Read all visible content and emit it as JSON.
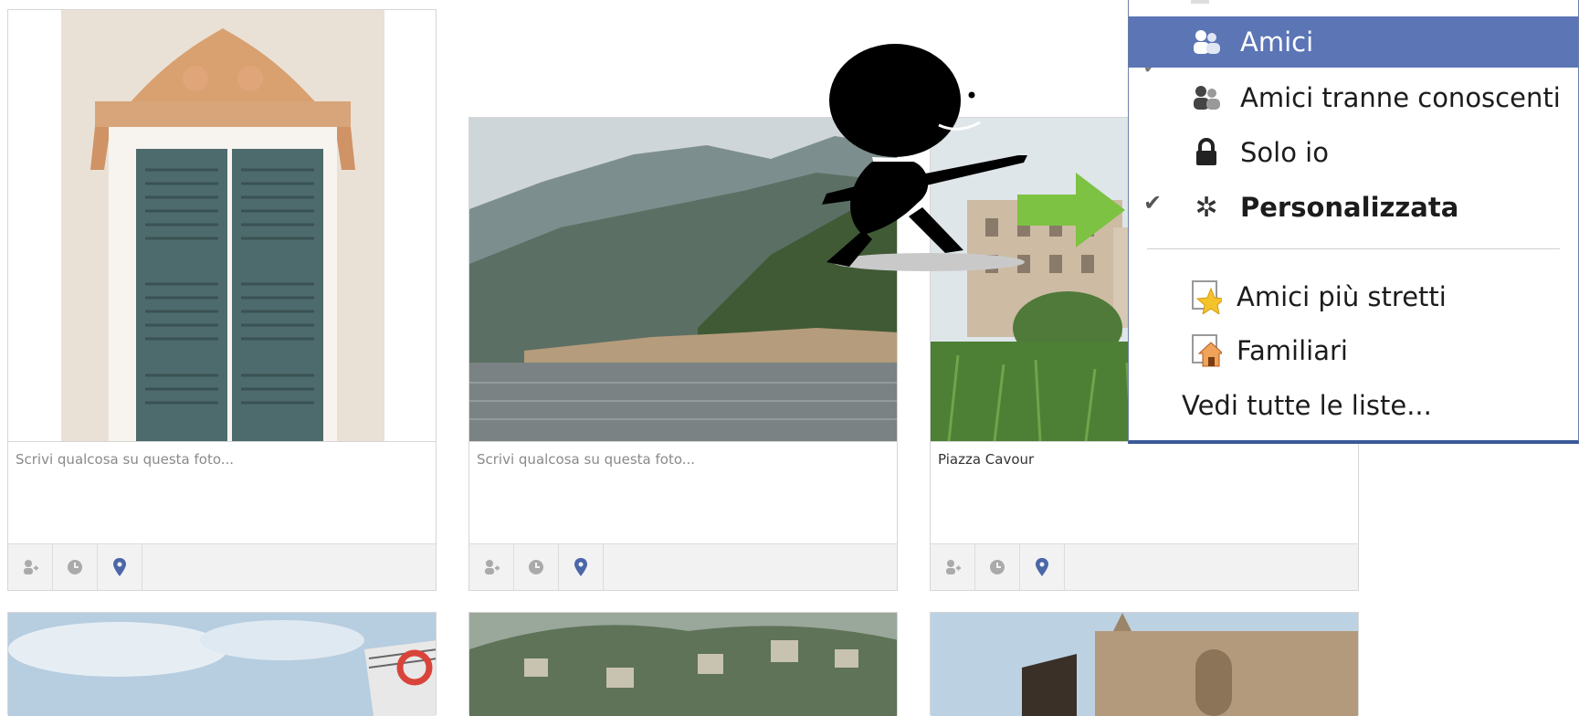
{
  "captions": {
    "photo1": "Scrivi qualcosa su questa foto...",
    "photo2": "Scrivi qualcosa su questa foto...",
    "photo3": "Piazza Cavour"
  },
  "toolbar_icons": [
    "tag-person-icon",
    "clock-icon",
    "location-pin-icon"
  ],
  "privacy_menu": {
    "items": [
      {
        "label": "Amici",
        "icon": "friends-icon",
        "selected": false,
        "highlighted": true
      },
      {
        "label": "Amici tranne conoscenti",
        "icon": "friends-except-icon",
        "selected": false
      },
      {
        "label": "Solo io",
        "icon": "lock-icon",
        "selected": false
      },
      {
        "label": "Personalizzata",
        "icon": "gear-icon",
        "selected": true
      }
    ],
    "lists": [
      {
        "label": "Amici più stretti",
        "icon": "star-list-icon"
      },
      {
        "label": "Familiari",
        "icon": "house-list-icon"
      }
    ],
    "see_all": "Vedi tutte le liste..."
  },
  "colors": {
    "highlight": "#5b75b5",
    "menu_border": "#3b5998",
    "arrow": "#7dc242",
    "pin": "#4b67a8"
  }
}
